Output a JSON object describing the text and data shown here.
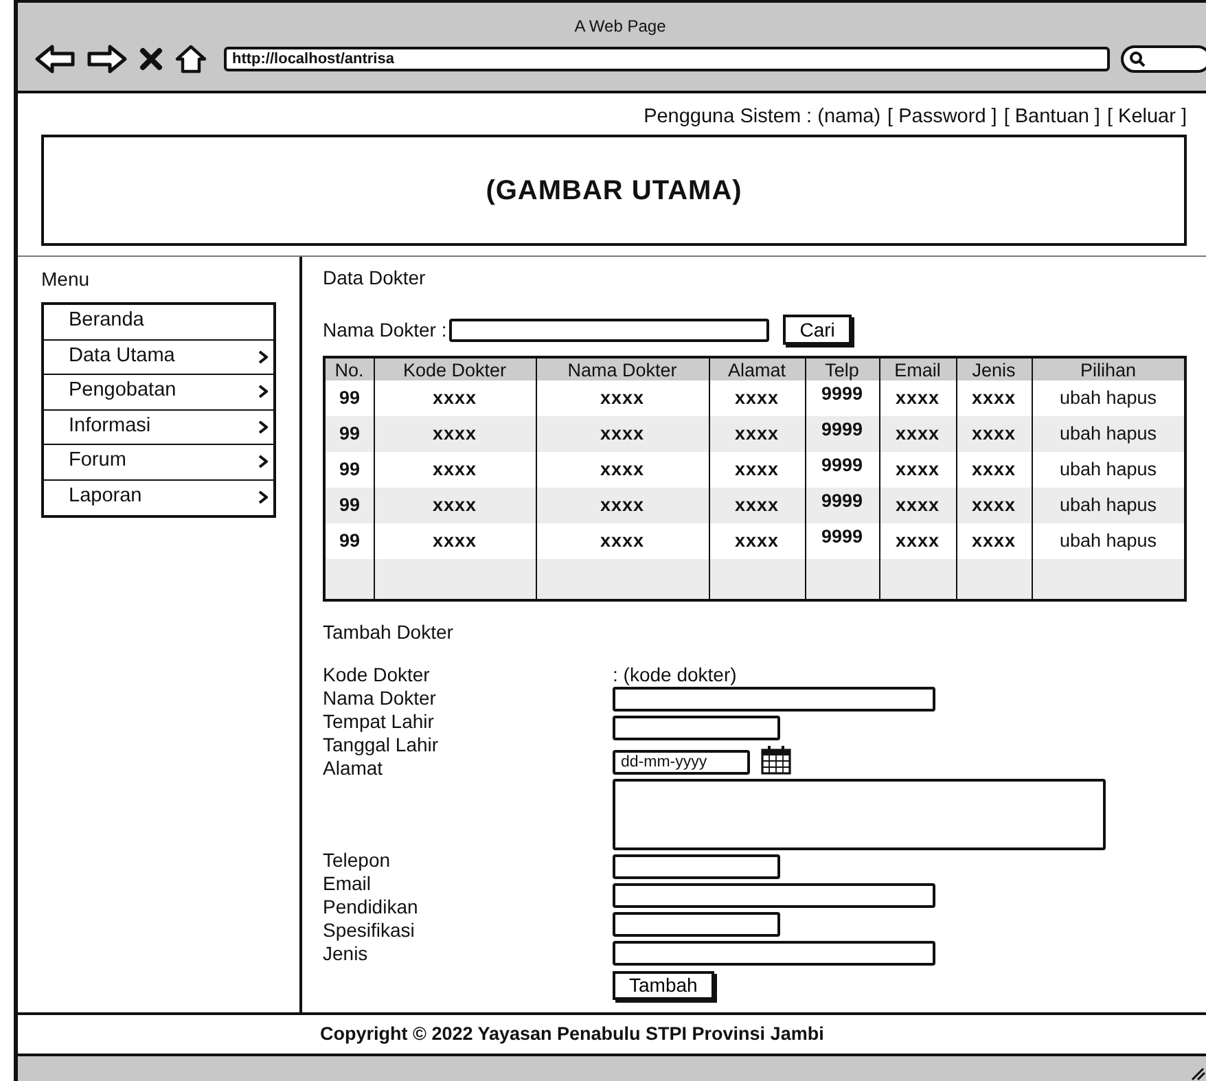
{
  "window": {
    "title": "A Web Page",
    "url": "http://localhost/antrisa"
  },
  "user_bar": {
    "label": "Pengguna Sistem : (nama)",
    "links": [
      "[ Password ]",
      "[ Bantuan ]",
      "[ Keluar ]"
    ]
  },
  "banner": {
    "text": "(GAMBAR UTAMA)"
  },
  "sidebar": {
    "title": "Menu",
    "items": [
      {
        "label": "Beranda",
        "has_submenu": false
      },
      {
        "label": "Data Utama",
        "has_submenu": true
      },
      {
        "label": "Pengobatan",
        "has_submenu": true
      },
      {
        "label": "Informasi",
        "has_submenu": true
      },
      {
        "label": "Forum",
        "has_submenu": true
      },
      {
        "label": "Laporan",
        "has_submenu": true
      }
    ]
  },
  "data_section": {
    "title": "Data Dokter",
    "search_label": "Nama Dokter :",
    "search_button": "Cari"
  },
  "table": {
    "columns": [
      "No.",
      "Kode Dokter",
      "Nama Dokter",
      "Alamat",
      "Telp",
      "Email",
      "Jenis",
      "Pilihan"
    ],
    "rows": [
      [
        "99",
        "xxxx",
        "xxxx",
        "xxxx",
        "9999",
        "xxxx",
        "xxxx",
        "ubah hapus"
      ],
      [
        "99",
        "xxxx",
        "xxxx",
        "xxxx",
        "9999",
        "xxxx",
        "xxxx",
        "ubah hapus"
      ],
      [
        "99",
        "xxxx",
        "xxxx",
        "xxxx",
        "9999",
        "xxxx",
        "xxxx",
        "ubah hapus"
      ],
      [
        "99",
        "xxxx",
        "xxxx",
        "xxxx",
        "9999",
        "xxxx",
        "xxxx",
        "ubah hapus"
      ],
      [
        "99",
        "xxxx",
        "xxxx",
        "xxxx",
        "9999",
        "xxxx",
        "xxxx",
        "ubah hapus"
      ]
    ]
  },
  "form": {
    "title": "Tambah Dokter",
    "labels_top": [
      "Kode Dokter",
      "Nama Dokter",
      "Tempat Lahir",
      "Tanggal Lahir",
      "Alamat"
    ],
    "labels_bottom": [
      "Telepon",
      "Email",
      "Pendidikan",
      "Spesifikasi",
      "Jenis"
    ],
    "kode_value": ": (kode dokter)",
    "inputs": [
      {
        "kind": "long"
      },
      {
        "kind": "short"
      },
      {
        "kind": "date",
        "placeholder": "dd-mm-yyyy"
      },
      {
        "kind": "textarea"
      },
      {
        "kind": "short"
      },
      {
        "kind": "long"
      },
      {
        "kind": "short"
      },
      {
        "kind": "long"
      }
    ],
    "submit": "Tambah"
  },
  "footer": {
    "text": "Copyright © 2022 Yayasan Penabulu STPI Provinsi Jambi"
  }
}
